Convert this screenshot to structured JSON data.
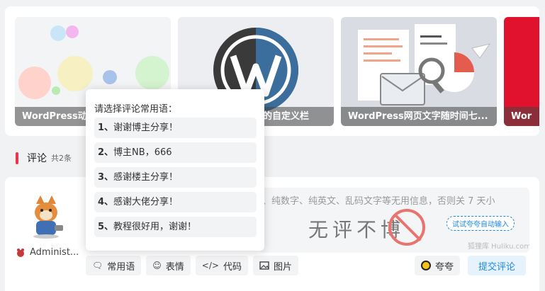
{
  "related_posts": [
    {
      "title": "WordPress动态"
    },
    {
      "title": "的自定义栏"
    },
    {
      "title": "WordPress网页文字随时间七..."
    },
    {
      "title": "Wor"
    }
  ],
  "comments": {
    "title": "评论",
    "count": "共2条"
  },
  "user": {
    "name": "Administ..."
  },
  "editor": {
    "placeholder": "、纯数字、纯英文、乱码文字等无用信息，否则关 7 天小",
    "watermark": "无评不博",
    "auto_input_label": "试试夸夸自动输入",
    "site_label": "狐狸库 Huliku.com"
  },
  "toolbar": {
    "phrases": "常用语",
    "emoji": "表情",
    "code": "代码",
    "image": "图片",
    "kuakua": "夸夸",
    "submit": "提交评论"
  },
  "popup": {
    "title": "请选择评论常用语：",
    "items": [
      {
        "num": "1、",
        "text": "谢谢博主分享！"
      },
      {
        "num": "2、",
        "text": "博主NB，666"
      },
      {
        "num": "3、",
        "text": "感谢楼主分享！"
      },
      {
        "num": "4、",
        "text": "感谢大佬分享！"
      },
      {
        "num": "5、",
        "text": "教程很好用，谢谢！"
      }
    ]
  },
  "colors": {
    "accent": "#f0324d",
    "link": "#1e88e5"
  }
}
